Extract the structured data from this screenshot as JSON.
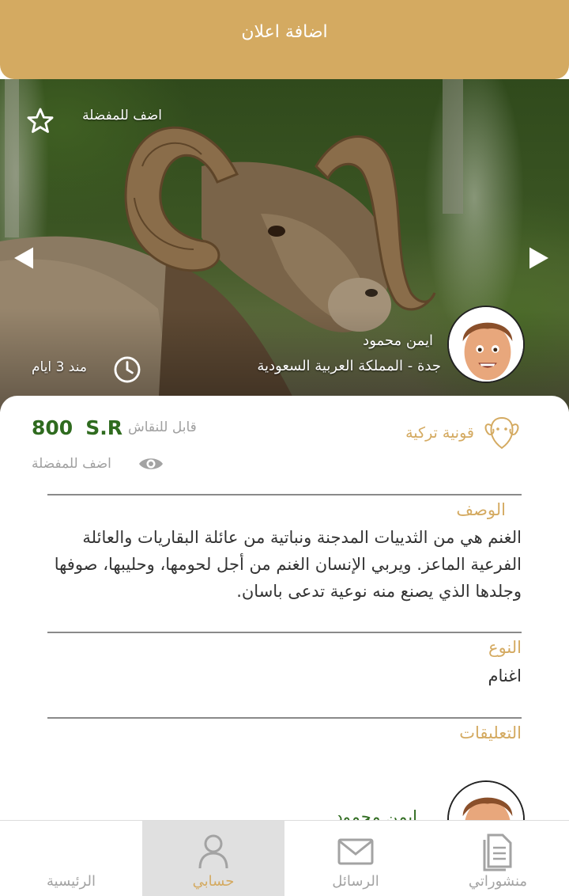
{
  "header": {
    "title": "اضافة اعلان"
  },
  "hero": {
    "favorite_label": "اضف للمفضلة",
    "owner_name": "ايمن محمود",
    "owner_location": "جدة - المملكة العربية السعودية",
    "posted_time": "مند 3 ايام",
    "icons": [
      "star-icon",
      "arrow-left-icon",
      "arrow-right-icon",
      "clock-icon",
      "avatar"
    ]
  },
  "listing": {
    "breed": "قونية تركية",
    "negotiable_label": "قابل للنقاش",
    "price_value": "800",
    "price_currency": "S.R",
    "favorite_label": "اضف للمفضلة",
    "description_title": "الوصف",
    "description": "الغنم هي من الثدييات المدجنة ونباتية من عائلة البقاريات والعائلة الفرعية الماعز. ويربي الإنسان الغنم من أجل لحومها، وحليبها، صوفها وجلدها الذي يصنع منه نوعية تدعى باسان.",
    "type_title": "النوع",
    "type_value": "اغنام",
    "comments_title": "التعليقات",
    "comment_author": "ايمن محمود"
  },
  "bottom_nav": {
    "items": [
      {
        "label": "الرئيسية",
        "icon": "home-icon"
      },
      {
        "label": "حسابي",
        "icon": "user-icon",
        "active": true
      },
      {
        "label": "الرسائل",
        "icon": "mail-icon"
      },
      {
        "label": "منشوراتي",
        "icon": "document-icon"
      }
    ]
  },
  "colors": {
    "brand_gold": "#d4aa61",
    "price_green": "#2f6b1f",
    "muted_gray": "#a3a3a3",
    "active_nav_bg": "#e0e0e0"
  }
}
